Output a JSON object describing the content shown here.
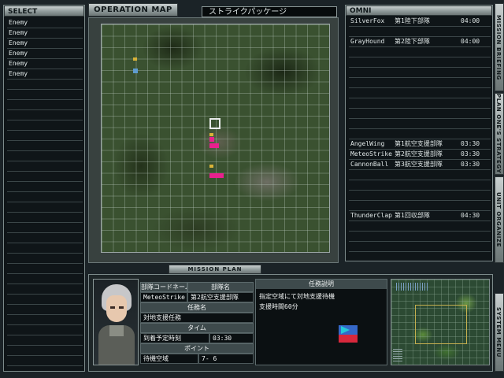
{
  "select_panel": {
    "title": "SELECT",
    "items": [
      "Enemy",
      "Enemy",
      "Enemy",
      "Enemy",
      "Enemy",
      "Enemy"
    ]
  },
  "map": {
    "header_label": "OPERATION MAP",
    "package_title": "ストライクパッケージ"
  },
  "omni": {
    "title": "OMNI",
    "rows": [
      {
        "callsign": "SilverFox",
        "unit": "第1陸下部隊",
        "time": "04:00"
      },
      {
        "callsign": "GrayHound",
        "unit": "第2陸下部隊",
        "time": "04:00"
      },
      {
        "callsign": "AngelWing",
        "unit": "第1航空支援部隊",
        "time": "03:30"
      },
      {
        "callsign": "MeteoStrike",
        "unit": "第2航空支援部隊",
        "time": "03:30"
      },
      {
        "callsign": "CannonBall",
        "unit": "第3航空支援部隊",
        "time": "03:30"
      },
      {
        "callsign": "ThunderClap",
        "unit": "第1回収部隊",
        "time": "04:30"
      }
    ]
  },
  "side_menu": {
    "mission_briefing": "MISSION BRIEFING",
    "plan_strategy": "PLAN ONE'S STRATEGY",
    "unit_organize": "UNIT ORGANIZE",
    "system_menu": "SYSTEM MENU"
  },
  "mission_plan": {
    "tab_label": "MISSION PLAN",
    "codename_header": "部隊コードネーム",
    "unitname_header": "部隊名",
    "codename": "MeteoStrike",
    "unitname": "第2航空支援部隊",
    "task_header": "任務名",
    "task": "対地支援任務",
    "time_header": "タイム",
    "eta_label": "到着予定時刻",
    "eta": "03:30",
    "point_header": "ポイント",
    "point_name": "待機空域",
    "point_coord": "7- 6",
    "briefing_header": "任務説明",
    "briefing_lines": [
      "指定空域にて対地支援待機",
      "支援時間60分"
    ]
  },
  "colors": {
    "marker_pink": "#e8208e",
    "marker_blue": "#5f9ccf",
    "marker_flag": "#d8b238"
  }
}
